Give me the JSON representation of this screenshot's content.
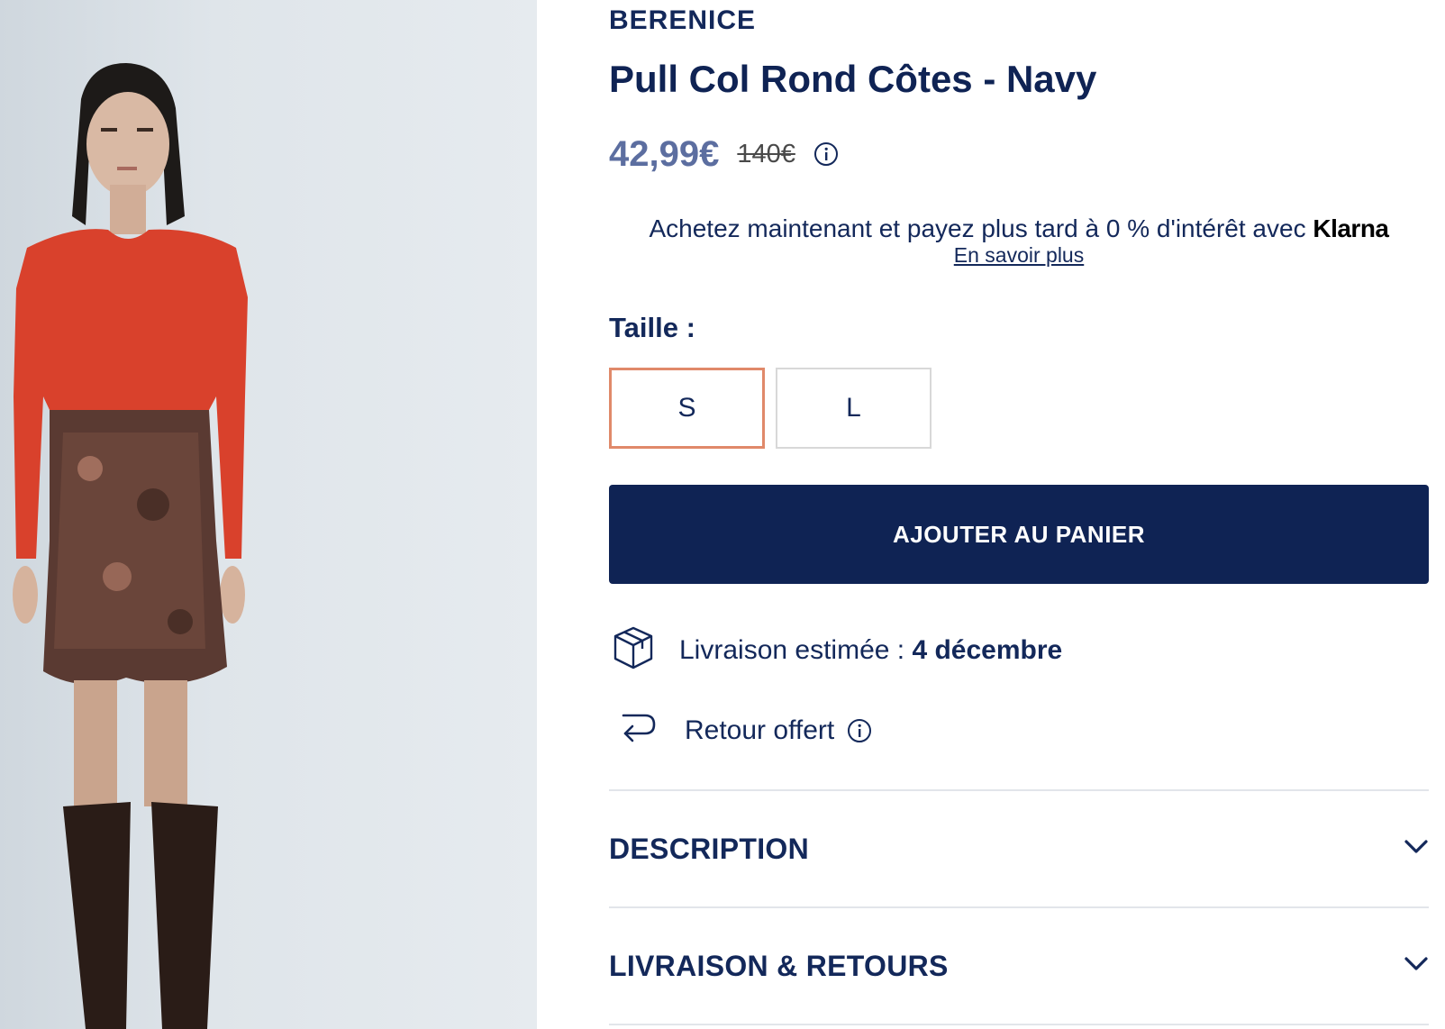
{
  "product": {
    "brand": "BERENICE",
    "title": "Pull Col Rond Côtes - Navy",
    "price_current": "42,99€",
    "price_old": "140€",
    "price_info_icon": "info-circle-icon"
  },
  "klarna": {
    "text": "Achetez maintenant et payez plus tard à 0 % d'intérêt avec",
    "brand": "Klarna",
    "link": "En savoir plus"
  },
  "size": {
    "label": "Taille :",
    "options": [
      "S",
      "L"
    ],
    "selected": "S"
  },
  "cart": {
    "button_label": "AJOUTER AU PANIER"
  },
  "delivery": {
    "icon": "package-box-icon",
    "label": "Livraison estimée :",
    "date": "4 décembre"
  },
  "returns": {
    "icon": "return-arrow-icon",
    "label": "Retour offert",
    "info_icon": "info-circle-icon"
  },
  "accordions": [
    {
      "label": "DESCRIPTION",
      "icon": "chevron-down-icon"
    },
    {
      "label": "LIVRAISON & RETOURS",
      "icon": "chevron-down-icon"
    }
  ],
  "colors": {
    "navy": "#0f2354",
    "price": "#5c6ea0",
    "selected_border": "#e0896a"
  }
}
